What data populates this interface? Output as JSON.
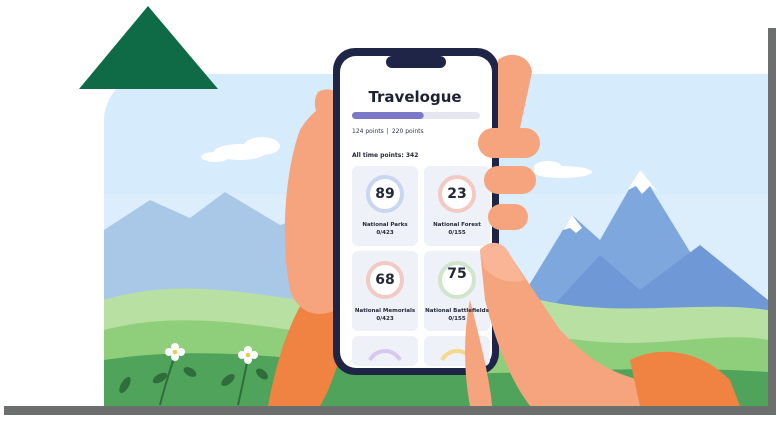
{
  "app": {
    "title": "Travelogue",
    "points_label": "124 points",
    "separator": "|",
    "total_points_label": "220 points",
    "progress_fraction": 0.56,
    "all_time_label": "All time points: 342"
  },
  "cards": [
    {
      "value": "89",
      "name": "National Parks",
      "fraction": "0/423",
      "ring_color": "#c9d6f2"
    },
    {
      "value": "23",
      "name": "National Forest",
      "fraction": "0/155",
      "ring_color": "#f3c9c4"
    },
    {
      "value": "68",
      "name": "National Memorials",
      "fraction": "0/423",
      "ring_color": "#f3c9c4"
    },
    {
      "value": "75",
      "name": "National Battlefields",
      "fraction": "0/155",
      "ring_color": "#cfe5cc"
    }
  ],
  "colors": {
    "accent_triangle": "#0f6b45",
    "progress_fill": "#7b78c7",
    "frame_dark": "#1e2547",
    "skin": "#f5a47d",
    "sleeve": "#f08242",
    "sky": "#d9ecfb",
    "shadow_bar": "#6a6e6c"
  }
}
